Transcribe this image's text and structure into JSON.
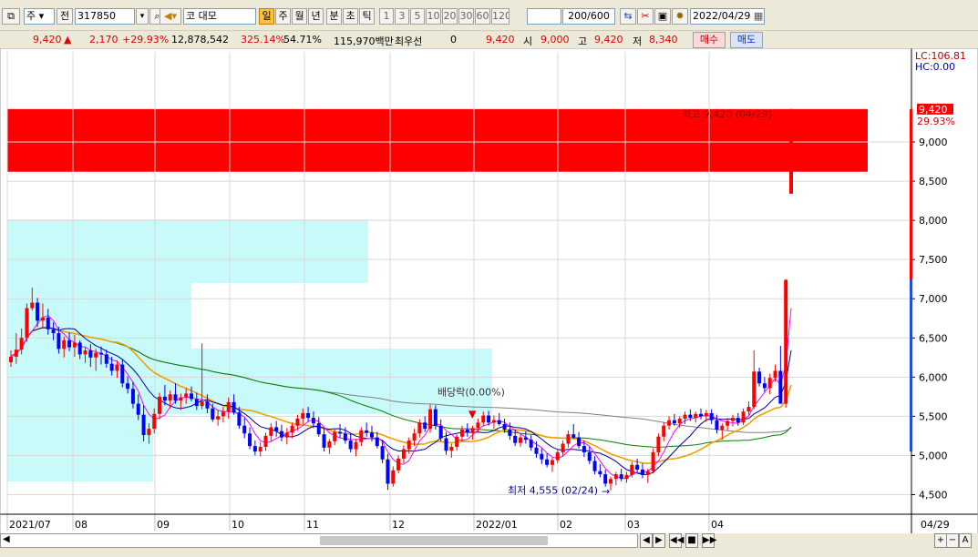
{
  "toolbar": {
    "market_1": "주",
    "prev_label": "전",
    "code": "317850",
    "name": "대모",
    "name_prefix": "코",
    "periods": [
      "일",
      "주",
      "월",
      "년",
      "분",
      "초",
      "틱"
    ],
    "active_period": "일",
    "minutes": [
      "1",
      "3",
      "5",
      "10",
      "20",
      "30",
      "60",
      "120"
    ],
    "count": "200",
    "count_total": "/600",
    "date": "2022/04/29"
  },
  "info": {
    "price": "9,420",
    "change": "2,170",
    "change_pct": "+29.93%",
    "volume": "12,878,542",
    "vol_ratio": "325.14%",
    "turnover": "54.71%",
    "amount": "115,970백만",
    "priority_label": "최우선",
    "priority_qty": "0",
    "priority_price": "9,420",
    "open_label": "시",
    "open": "9,000",
    "high_label": "고",
    "high": "9,420",
    "low_label": "저",
    "low": "8,340",
    "buy": "매수",
    "sell": "매도"
  },
  "chart_data": {
    "type": "candlestick",
    "y_ticks": [
      4500,
      5000,
      5500,
      6000,
      6500,
      7000,
      7500,
      8000,
      8500,
      9000
    ],
    "y_tick_labels": [
      "4,500",
      "5,000",
      "5,500",
      "6,000",
      "6,500",
      "7,000",
      "7,500",
      "8,000",
      "8,500",
      "9,000"
    ],
    "ylim": [
      4250,
      10150
    ],
    "x_labels": [
      "2021/07",
      "08",
      "09",
      "10",
      "11",
      "12",
      "2022/01",
      "02",
      "03",
      "04",
      "04/29"
    ],
    "top_right": {
      "lc": "LC:106.81",
      "hc": "HC:0.00",
      "last_price": "9,420",
      "last_pct": "29.93%"
    },
    "annotations": {
      "high": "최고 9,420 (04/29)",
      "low": "최저 4,555 (02/24)",
      "dividend": "배당락(0.00%)"
    },
    "highlight_colors": {
      "price_zone": "#ff0000",
      "volume_zone": "#c8fafa"
    },
    "series_colors": {
      "up": "#ff0000",
      "down": "#0000ff",
      "ma5": "#ff00ff",
      "ma10": "#0000a0",
      "ma20": "#f0a000",
      "ma60": "#008000",
      "ma120": "#808080"
    },
    "candles": [
      [
        6190,
        6340,
        6130,
        6260
      ],
      [
        6260,
        6560,
        6170,
        6350
      ],
      [
        6350,
        6620,
        6290,
        6500
      ],
      [
        6500,
        6940,
        6450,
        6880
      ],
      [
        6880,
        7140,
        6850,
        6950
      ],
      [
        6950,
        7010,
        6640,
        6720
      ],
      [
        6720,
        6940,
        6620,
        6760
      ],
      [
        6760,
        6870,
        6540,
        6610
      ],
      [
        6610,
        6700,
        6470,
        6560
      ],
      [
        6560,
        6640,
        6300,
        6360
      ],
      [
        6360,
        6520,
        6250,
        6470
      ],
      [
        6470,
        6570,
        6330,
        6380
      ],
      [
        6380,
        6540,
        6260,
        6440
      ],
      [
        6440,
        6470,
        6230,
        6290
      ],
      [
        6290,
        6380,
        6180,
        6340
      ],
      [
        6340,
        6420,
        6130,
        6250
      ],
      [
        6250,
        6360,
        6080,
        6310
      ],
      [
        6310,
        6390,
        6160,
        6290
      ],
      [
        6290,
        6350,
        6120,
        6170
      ],
      [
        6170,
        6260,
        6020,
        6080
      ],
      [
        6080,
        6210,
        5990,
        6160
      ],
      [
        6160,
        6230,
        5870,
        5920
      ],
      [
        5920,
        6010,
        5790,
        5850
      ],
      [
        5850,
        5940,
        5600,
        5660
      ],
      [
        5660,
        5780,
        5450,
        5520
      ],
      [
        5520,
        5640,
        5180,
        5260
      ],
      [
        5260,
        5410,
        5150,
        5340
      ],
      [
        5340,
        5600,
        5280,
        5530
      ],
      [
        5530,
        5800,
        5460,
        5750
      ],
      [
        5750,
        5900,
        5640,
        5700
      ],
      [
        5700,
        5830,
        5600,
        5780
      ],
      [
        5780,
        5920,
        5660,
        5700
      ],
      [
        5700,
        5790,
        5580,
        5740
      ],
      [
        5740,
        5860,
        5660,
        5790
      ],
      [
        5790,
        5880,
        5690,
        5720
      ],
      [
        5720,
        5800,
        5580,
        5630
      ],
      [
        5630,
        6430,
        5590,
        5690
      ],
      [
        5690,
        5780,
        5540,
        5600
      ],
      [
        5600,
        5660,
        5430,
        5460
      ],
      [
        5460,
        5580,
        5380,
        5500
      ],
      [
        5500,
        5620,
        5420,
        5560
      ],
      [
        5560,
        5740,
        5470,
        5680
      ],
      [
        5680,
        5780,
        5520,
        5550
      ],
      [
        5550,
        5620,
        5340,
        5380
      ],
      [
        5380,
        5480,
        5220,
        5280
      ],
      [
        5280,
        5360,
        5080,
        5120
      ],
      [
        5120,
        5190,
        5000,
        5050
      ],
      [
        5050,
        5170,
        4990,
        5110
      ],
      [
        5110,
        5290,
        5060,
        5250
      ],
      [
        5250,
        5410,
        5180,
        5360
      ],
      [
        5360,
        5440,
        5240,
        5310
      ],
      [
        5310,
        5390,
        5180,
        5230
      ],
      [
        5230,
        5350,
        5140,
        5290
      ],
      [
        5290,
        5420,
        5220,
        5380
      ],
      [
        5380,
        5520,
        5320,
        5470
      ],
      [
        5470,
        5600,
        5400,
        5540
      ],
      [
        5540,
        5620,
        5430,
        5480
      ],
      [
        5480,
        5560,
        5350,
        5410
      ],
      [
        5410,
        5490,
        5240,
        5270
      ],
      [
        5270,
        5350,
        5050,
        5100
      ],
      [
        5100,
        5210,
        5020,
        5180
      ],
      [
        5180,
        5330,
        5130,
        5300
      ],
      [
        5300,
        5400,
        5220,
        5280
      ],
      [
        5280,
        5360,
        5150,
        5190
      ],
      [
        5190,
        5280,
        5040,
        5080
      ],
      [
        5080,
        5210,
        4990,
        5170
      ],
      [
        5170,
        5360,
        5120,
        5320
      ],
      [
        5320,
        5420,
        5240,
        5290
      ],
      [
        5290,
        5380,
        5180,
        5230
      ],
      [
        5230,
        5300,
        5090,
        5120
      ],
      [
        5120,
        5190,
        4900,
        4950
      ],
      [
        4950,
        5020,
        4560,
        4640
      ],
      [
        4640,
        4860,
        4600,
        4810
      ],
      [
        4810,
        5000,
        4770,
        4960
      ],
      [
        4960,
        5130,
        4900,
        5080
      ],
      [
        5080,
        5230,
        5020,
        5190
      ],
      [
        5190,
        5340,
        5120,
        5280
      ],
      [
        5280,
        5460,
        5230,
        5420
      ],
      [
        5420,
        5500,
        5300,
        5340
      ],
      [
        5340,
        5650,
        5290,
        5590
      ],
      [
        5590,
        5640,
        5330,
        5380
      ],
      [
        5380,
        5460,
        5180,
        5220
      ],
      [
        5220,
        5300,
        5010,
        5060
      ],
      [
        5060,
        5150,
        4970,
        5110
      ],
      [
        5110,
        5270,
        5060,
        5240
      ],
      [
        5240,
        5380,
        5180,
        5330
      ],
      [
        5330,
        5410,
        5240,
        5290
      ],
      [
        5290,
        5380,
        5200,
        5350
      ],
      [
        5350,
        5470,
        5300,
        5420
      ],
      [
        5420,
        5560,
        5370,
        5510
      ],
      [
        5510,
        5570,
        5380,
        5420
      ],
      [
        5420,
        5510,
        5340,
        5450
      ],
      [
        5450,
        5540,
        5380,
        5400
      ],
      [
        5400,
        5470,
        5290,
        5330
      ],
      [
        5330,
        5420,
        5200,
        5250
      ],
      [
        5250,
        5330,
        5120,
        5160
      ],
      [
        5160,
        5280,
        5110,
        5230
      ],
      [
        5230,
        5310,
        5150,
        5200
      ],
      [
        5200,
        5260,
        5060,
        5100
      ],
      [
        5100,
        5180,
        4970,
        5020
      ],
      [
        5020,
        5090,
        4890,
        4950
      ],
      [
        4950,
        5030,
        4850,
        4880
      ],
      [
        4880,
        4970,
        4790,
        4940
      ],
      [
        4940,
        5080,
        4900,
        5040
      ],
      [
        5040,
        5190,
        4990,
        5150
      ],
      [
        5150,
        5320,
        5100,
        5270
      ],
      [
        5270,
        5400,
        5210,
        5230
      ],
      [
        5230,
        5300,
        5090,
        5120
      ],
      [
        5120,
        5190,
        4980,
        5040
      ],
      [
        5040,
        5110,
        4890,
        4930
      ],
      [
        4930,
        4990,
        4760,
        4800
      ],
      [
        4800,
        4890,
        4720,
        4760
      ],
      [
        4760,
        4820,
        4600,
        4640
      ],
      [
        4640,
        4730,
        4555,
        4700
      ],
      [
        4700,
        4790,
        4620,
        4760
      ],
      [
        4760,
        4830,
        4670,
        4700
      ],
      [
        4700,
        4790,
        4650,
        4750
      ],
      [
        4750,
        4920,
        4720,
        4880
      ],
      [
        4880,
        4960,
        4780,
        4820
      ],
      [
        4820,
        4900,
        4710,
        4750
      ],
      [
        4750,
        4830,
        4650,
        4800
      ],
      [
        4800,
        5090,
        4770,
        5040
      ],
      [
        5040,
        5280,
        4990,
        5240
      ],
      [
        5240,
        5420,
        5180,
        5380
      ],
      [
        5380,
        5500,
        5330,
        5450
      ],
      [
        5450,
        5530,
        5380,
        5410
      ],
      [
        5410,
        5500,
        5350,
        5470
      ],
      [
        5470,
        5560,
        5400,
        5520
      ],
      [
        5520,
        5590,
        5440,
        5480
      ],
      [
        5480,
        5560,
        5420,
        5530
      ],
      [
        5530,
        5600,
        5460,
        5500
      ],
      [
        5500,
        5580,
        5430,
        5540
      ],
      [
        5540,
        5590,
        5400,
        5450
      ],
      [
        5450,
        5520,
        5280,
        5330
      ],
      [
        5330,
        5410,
        5200,
        5380
      ],
      [
        5380,
        5480,
        5320,
        5440
      ],
      [
        5440,
        5520,
        5370,
        5480
      ],
      [
        5480,
        5540,
        5380,
        5420
      ],
      [
        5420,
        5600,
        5390,
        5560
      ],
      [
        5560,
        5690,
        5500,
        5620
      ],
      [
        5620,
        6340,
        5590,
        6070
      ],
      [
        6070,
        6120,
        5880,
        5920
      ],
      [
        5920,
        6000,
        5810,
        5860
      ],
      [
        5860,
        6040,
        5780,
        5990
      ],
      [
        5990,
        6160,
        5940,
        6080
      ],
      [
        6080,
        6400,
        6020,
        5660
      ],
      [
        5660,
        7250,
        5610,
        7240
      ],
      [
        8340,
        9420,
        8340,
        9420
      ]
    ]
  },
  "statusbar": {
    "btns": [
      "◀",
      "▶",
      "◀◀",
      "■",
      "▶▶",
      "+",
      "−",
      "A"
    ]
  }
}
